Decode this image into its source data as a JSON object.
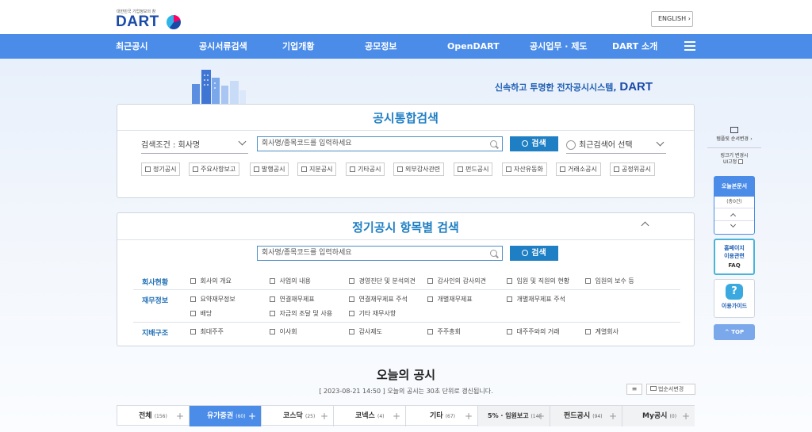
{
  "header": {
    "logo_tagline": "대한민국 기업정보의 창",
    "logo_text": "DART",
    "english_button": "ENGLISH",
    "english_arrow": "›"
  },
  "nav": {
    "items": [
      "최근공시",
      "공시서류검색",
      "기업개황",
      "공모정보",
      "OpenDART",
      "공시업무 · 제도",
      "DART 소개"
    ]
  },
  "slogan": {
    "text": "신속하고 투명한 전자공시시스템,",
    "brand": "DART"
  },
  "integrated_search": {
    "title": "공시통합검색",
    "condition_select": "검색조건 : 회사명",
    "input_placeholder": "회사명/종목코드를 입력하세요",
    "search_button": "검색",
    "recent_select": "최근검색어 선택",
    "checkboxes": [
      "정기공시",
      "주요사항보고",
      "발행공시",
      "지분공시",
      "기타공시",
      "외부감사관련",
      "펀드공시",
      "자산유동화",
      "거래소공시",
      "공정위공시"
    ]
  },
  "periodic_search": {
    "title": "정기공시 항목별 검색",
    "input_placeholder": "회사명/종목코드를 입력하세요",
    "search_button": "검색",
    "categories": {
      "company": {
        "label": "회사현황",
        "items": [
          "회사의 개요",
          "사업의 내용",
          "경영진단 및 분석의견",
          "감사인의 감사의견",
          "임원 및 직원의 현황",
          "임원의 보수 등"
        ]
      },
      "finance": {
        "label": "재무정보",
        "items": [
          "요약재무정보",
          "연결재무제표",
          "연결재무제표 주석",
          "개별재무제표",
          "개별재무제표 주석",
          "배당",
          "자금의 조달 및 사용",
          "기타 재무사항"
        ]
      },
      "governance": {
        "label": "지배구조",
        "items": [
          "최대주주",
          "이사회",
          "감사제도",
          "주주총회",
          "대주주와의 거래",
          "계열회사"
        ]
      }
    }
  },
  "today": {
    "title": "오늘의 공시",
    "subtitle": "[ 2023-08-21 14:50 ] 오늘의 공시는 30초 단위로 갱신됩니다.",
    "order_button": "법순서변경",
    "tabs": [
      {
        "label": "전체",
        "count": "(156)"
      },
      {
        "label": "유가증권",
        "count": "(60)"
      },
      {
        "label": "코스닥",
        "count": "(25)"
      },
      {
        "label": "코넥스",
        "count": "(4)"
      },
      {
        "label": "기타",
        "count": "(67)"
      },
      {
        "label": "5% · 임원보고",
        "count": "(14)"
      },
      {
        "label": "펀드공시",
        "count": "(94)"
      },
      {
        "label": "My공시",
        "count": "(0)"
      }
    ]
  },
  "sidebar": {
    "template_label": "템플릿 순서변경",
    "template_arrow": "›",
    "link_toggle_line1": "링크기 변경시",
    "link_toggle_line2": "UI고정",
    "today_docs_title": "오늘본문서",
    "today_docs_count": "(총0건)",
    "homepage_faq_line1": "홈페이지",
    "homepage_faq_line2": "이용관련",
    "homepage_faq_line3": "FAQ",
    "guide_label": "이용가이드",
    "top_label": "TOP"
  },
  "colors": {
    "nav_blue": "#4a8ce8",
    "title_blue": "#1f7fc4",
    "brand_navy": "#1a4aa8"
  }
}
